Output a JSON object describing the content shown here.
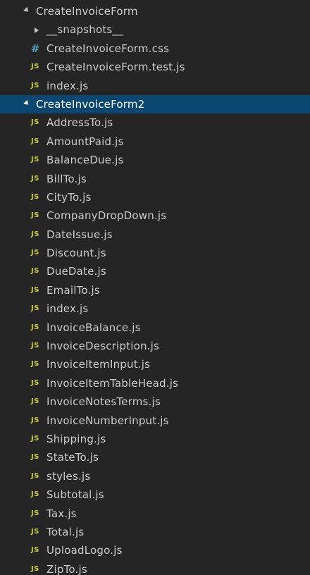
{
  "tree": {
    "folder1": {
      "label": "CreateInvoiceForm",
      "snapshots": "__snapshots__",
      "files": [
        {
          "label": "CreateInvoiceForm.css",
          "icon": "css"
        },
        {
          "label": "CreateInvoiceForm.test.js",
          "icon": "js"
        },
        {
          "label": "index.js",
          "icon": "js"
        }
      ]
    },
    "folder2": {
      "label": "CreateInvoiceForm2",
      "files": [
        {
          "label": "AddressTo.js",
          "icon": "js"
        },
        {
          "label": "AmountPaid.js",
          "icon": "js"
        },
        {
          "label": "BalanceDue.js",
          "icon": "js"
        },
        {
          "label": "BillTo.js",
          "icon": "js"
        },
        {
          "label": "CityTo.js",
          "icon": "js"
        },
        {
          "label": "CompanyDropDown.js",
          "icon": "js"
        },
        {
          "label": "DateIssue.js",
          "icon": "js"
        },
        {
          "label": "Discount.js",
          "icon": "js"
        },
        {
          "label": "DueDate.js",
          "icon": "js"
        },
        {
          "label": "EmailTo.js",
          "icon": "js"
        },
        {
          "label": "index.js",
          "icon": "js"
        },
        {
          "label": "InvoiceBalance.js",
          "icon": "js"
        },
        {
          "label": "InvoiceDescription.js",
          "icon": "js"
        },
        {
          "label": "InvoiceItemInput.js",
          "icon": "js"
        },
        {
          "label": "InvoiceItemTableHead.js",
          "icon": "js"
        },
        {
          "label": "InvoiceNotesTerms.js",
          "icon": "js"
        },
        {
          "label": "InvoiceNumberInput.js",
          "icon": "js"
        },
        {
          "label": "Shipping.js",
          "icon": "js"
        },
        {
          "label": "StateTo.js",
          "icon": "js"
        },
        {
          "label": "styles.js",
          "icon": "js"
        },
        {
          "label": "Subtotal.js",
          "icon": "js"
        },
        {
          "label": "Tax.js",
          "icon": "js"
        },
        {
          "label": "Total.js",
          "icon": "js"
        },
        {
          "label": "UploadLogo.js",
          "icon": "js"
        },
        {
          "label": "ZipTo.js",
          "icon": "js"
        }
      ]
    }
  },
  "icons": {
    "js_glyph": "JS",
    "css_glyph": "#"
  },
  "colors": {
    "background": "#252526",
    "selection": "#094771",
    "js_icon": "#cbcb41",
    "css_icon": "#519aba",
    "text": "#cccccc"
  }
}
